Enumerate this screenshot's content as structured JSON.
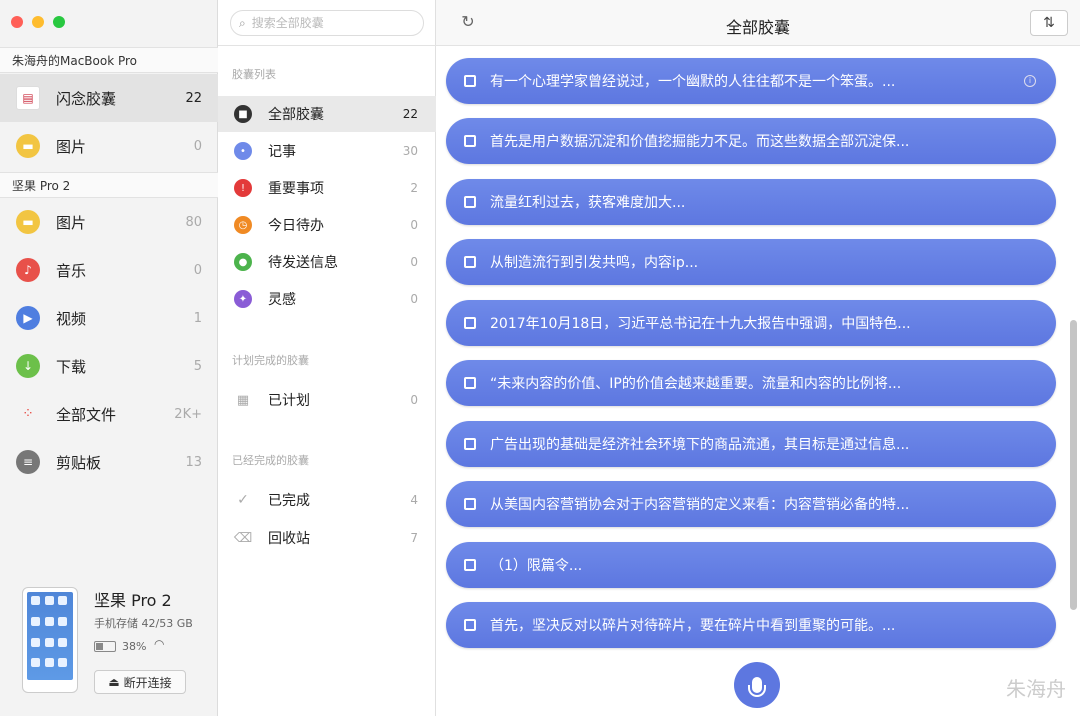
{
  "left": {
    "devices": [
      {
        "name": "朱海舟的MacBook Pro"
      },
      {
        "name": "坚果 Pro 2"
      }
    ],
    "items": [
      {
        "label": "闪念胶囊",
        "count": "22",
        "icon": "capsule-icon",
        "color": "#cc3344"
      },
      {
        "label": "图片",
        "count": "0",
        "icon": "photo-icon",
        "color": "#f2c542"
      },
      {
        "label": "图片",
        "count": "80",
        "icon": "photo-icon",
        "color": "#f2c542"
      },
      {
        "label": "音乐",
        "count": "0",
        "icon": "music-icon",
        "color": "#e8514a"
      },
      {
        "label": "视频",
        "count": "1",
        "icon": "video-icon",
        "color": "#4f7ee0"
      },
      {
        "label": "下载",
        "count": "5",
        "icon": "download-icon",
        "color": "#6cc04a"
      },
      {
        "label": "全部文件",
        "count": "2K+",
        "icon": "all-files-icon",
        "color": "#e5e5e5"
      },
      {
        "label": "剪贴板",
        "count": "13",
        "icon": "clipboard-icon",
        "color": "#777777"
      }
    ],
    "phone": {
      "name": "坚果 Pro 2",
      "storage": "手机存储 42/53 GB",
      "battery": "38%",
      "disconnect": "断开连接"
    }
  },
  "mid": {
    "search_placeholder": "搜索全部胶囊",
    "sections": [
      "胶囊列表",
      "计划完成的胶囊",
      "已经完成的胶囊"
    ],
    "items": [
      {
        "label": "全部胶囊",
        "count": "22",
        "icon": "all-capsules-icon",
        "color": "#333333"
      },
      {
        "label": "记事",
        "count": "30",
        "icon": "note-icon",
        "color": "#6f8ae9"
      },
      {
        "label": "重要事项",
        "count": "2",
        "icon": "important-icon",
        "color": "#e33a3a"
      },
      {
        "label": "今日待办",
        "count": "0",
        "icon": "todo-icon",
        "color": "#f08a24"
      },
      {
        "label": "待发送信息",
        "count": "0",
        "icon": "message-icon",
        "color": "#4cb34c"
      },
      {
        "label": "灵感",
        "count": "0",
        "icon": "idea-icon",
        "color": "#8a5cd6"
      },
      {
        "label": "已计划",
        "count": "0",
        "icon": "calendar-icon",
        "color": "#aaaaaa"
      },
      {
        "label": "已完成",
        "count": "4",
        "icon": "check-icon",
        "color": "#aaaaaa"
      },
      {
        "label": "回收站",
        "count": "7",
        "icon": "trash-icon",
        "color": "#aaaaaa"
      }
    ]
  },
  "right": {
    "title": "全部胶囊",
    "capsules": [
      "有一个心理学家曾经说过，一个幽默的人往往都不是一个笨蛋。...",
      "首先是用户数据沉淀和价值挖掘能力不足。而这些数据全部沉淀保...",
      "流量红利过去，获客难度加大...",
      "从制造流行到引发共鸣，内容ip...",
      "2017年10月18日，习近平总书记在十九大报告中强调，中国特色...",
      "“未来内容的价值、IP的价值会越来越重要。流量和内容的比例将...",
      "广告出现的基础是经济社会环境下的商品流通，其目标是通过信息...",
      "从美国内容营销协会对于内容营销的定义来看：内容营销必备的特...",
      "（1）限篇令...",
      "首先，坚决反对以碎片对待碎片，要在碎片中看到重聚的可能。..."
    ]
  },
  "watermark": "朱海舟"
}
